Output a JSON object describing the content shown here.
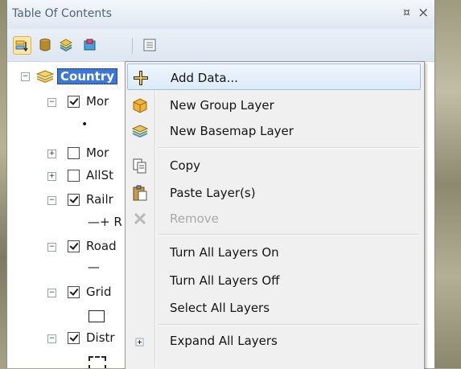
{
  "panel": {
    "title": "Table Of Contents",
    "pin_glyph": "¤",
    "close_glyph": "×"
  },
  "toolbar": {
    "buttons": [
      {
        "icon": "list-by-drawing-order-icon",
        "active": true
      },
      {
        "icon": "list-by-source-icon",
        "active": false
      },
      {
        "icon": "list-by-visibility-icon",
        "active": false
      },
      {
        "icon": "list-by-selection-icon",
        "active": false
      },
      {
        "icon": "options-icon",
        "active": false
      }
    ]
  },
  "tree": {
    "root_label": "Country",
    "layers": [
      {
        "label": "Mor",
        "checked": true,
        "expanded": true
      },
      {
        "label": "•",
        "symbol": true
      },
      {
        "label": "Mor",
        "checked": false,
        "expanded": false
      },
      {
        "label": "AllSt",
        "checked": false,
        "expanded": false
      },
      {
        "label": "Railr",
        "checked": true,
        "expanded": true
      },
      {
        "label": "—+ R",
        "symbol": true
      },
      {
        "label": "Road",
        "checked": true,
        "expanded": true
      },
      {
        "label": "—",
        "symbol": true
      },
      {
        "label": "Grid",
        "checked": true,
        "expanded": true
      },
      {
        "label": "",
        "symbol": true
      },
      {
        "label": "Distr",
        "checked": true,
        "expanded": true
      },
      {
        "label": "",
        "symbol": true
      }
    ]
  },
  "context_menu": {
    "items": [
      {
        "label": "Add Data...",
        "icon": "add-data-icon",
        "highlighted": true
      },
      {
        "label": "New Group Layer",
        "icon": "group-layer-icon"
      },
      {
        "label": "New Basemap Layer",
        "icon": "basemap-layer-icon"
      },
      {
        "label": "Copy",
        "icon": "copy-icon"
      },
      {
        "label": "Paste Layer(s)",
        "icon": "paste-icon"
      },
      {
        "label": "Remove",
        "icon": "remove-icon",
        "disabled": true
      },
      {
        "label": "Turn All Layers On"
      },
      {
        "label": "Turn All Layers Off"
      },
      {
        "label": "Select All Layers"
      },
      {
        "label": "Expand All Layers",
        "icon": "expand-icon"
      }
    ]
  },
  "colors": {
    "highlight": "#dcebfa",
    "root_selection": "#3b77d8",
    "title_text": "#4e647d"
  }
}
